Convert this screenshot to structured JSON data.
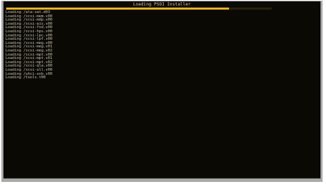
{
  "window": {
    "title": "Loading PSOI Installer"
  },
  "progress": {
    "fraction": 0.84,
    "color": "#f5b700"
  },
  "log_lines": [
    "Loading /ata-sat.d03",
    "Loading /scsi-mem.v00",
    "Loading /scsi-mdp.v00",
    "Loading /scsi-ais.v00",
    "Loading /scsi-fsd.v00",
    "Loading /scsi-hps.v00",
    "Loading /scsi-lpc.v00",
    "Loading /scsi-lpf.v00",
    "Loading /scsi-meg.v00",
    "Loading /scsi-meg.v01",
    "Loading /scsi-meg.v02",
    "Loading /scsi-mpt.v00",
    "Loading /scsi-mpt.v01",
    "Loading /scsi-mpt.v02",
    "Loading /scsi-qla.v00",
    "Loading /scsi-ull.v00",
    "Loading /uhci-usb.v00",
    "Loading /tools.t00"
  ]
}
